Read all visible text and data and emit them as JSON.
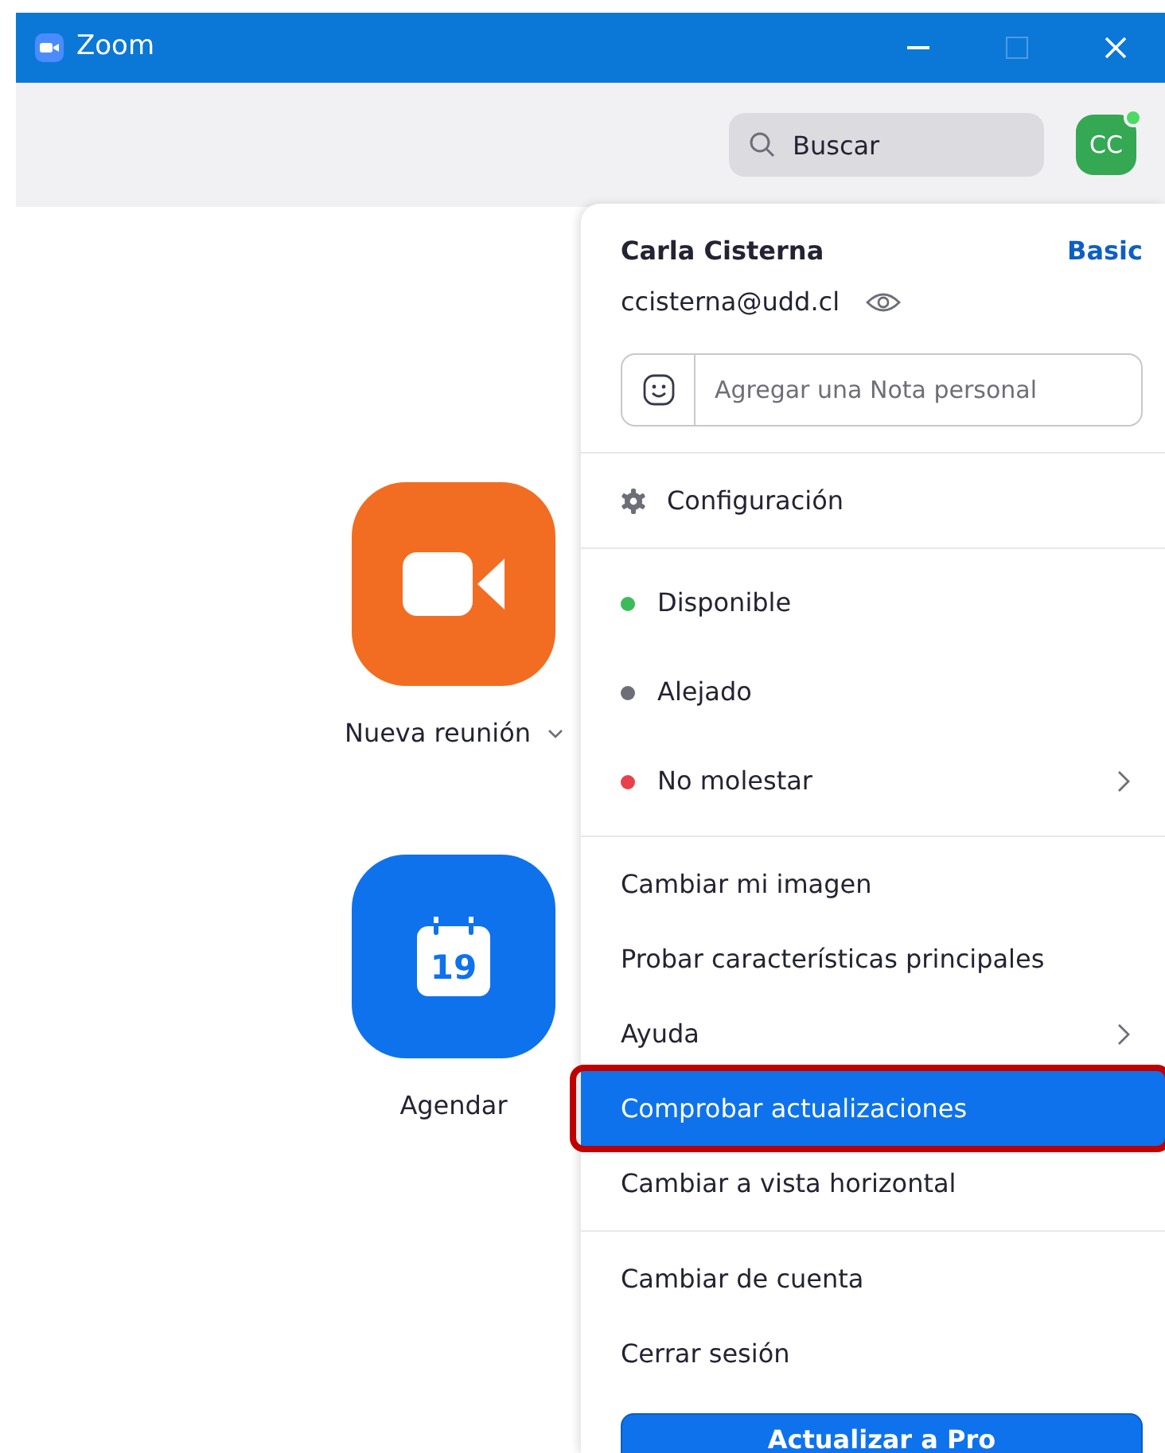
{
  "window": {
    "title": "Zoom"
  },
  "search": {
    "placeholder": "Buscar"
  },
  "avatar": {
    "initials": "CC",
    "online": true
  },
  "home_buttons": [
    {
      "kind": "video",
      "label": "Nueva reunión",
      "has_menu": true
    },
    {
      "kind": "calendar",
      "label": "Agendar",
      "day": "19"
    }
  ],
  "menu": {
    "name": "Carla Cisterna",
    "plan": "Basic",
    "email": "ccisterna@udd.cl",
    "note": {
      "placeholder": "Agregar una Nota personal"
    },
    "sections": [
      [
        {
          "kind": "settings",
          "label": "Configuración",
          "submenu": false,
          "selected": false,
          "annotated": false
        }
      ],
      [
        {
          "kind": "status",
          "label": "Disponible",
          "color": "#3dbb5b",
          "submenu": false,
          "selected": false,
          "annotated": false
        },
        {
          "kind": "status",
          "label": "Alejado",
          "color": "#6e6e78",
          "submenu": false,
          "selected": false,
          "annotated": false
        },
        {
          "kind": "status",
          "label": "No molestar",
          "color": "#e8414c",
          "submenu": true,
          "selected": false,
          "annotated": false
        }
      ],
      [
        {
          "kind": "plain",
          "label": "Cambiar mi imagen",
          "submenu": false,
          "selected": false,
          "annotated": false
        },
        {
          "kind": "plain",
          "label": "Probar características principales",
          "submenu": false,
          "selected": false,
          "annotated": false
        },
        {
          "kind": "plain",
          "label": "Ayuda",
          "submenu": true,
          "selected": false,
          "annotated": false
        },
        {
          "kind": "plain",
          "label": "Comprobar actualizaciones",
          "submenu": false,
          "selected": true,
          "annotated": true
        },
        {
          "kind": "plain",
          "label": "Cambiar a vista horizontal",
          "submenu": false,
          "selected": false,
          "annotated": false
        }
      ],
      [
        {
          "kind": "plain",
          "label": "Cambiar de cuenta",
          "submenu": false,
          "selected": false,
          "annotated": false
        },
        {
          "kind": "plain",
          "label": "Cerrar sesión",
          "submenu": false,
          "selected": false,
          "annotated": false
        }
      ]
    ],
    "upgrade_button": "Actualizar a Pro"
  }
}
